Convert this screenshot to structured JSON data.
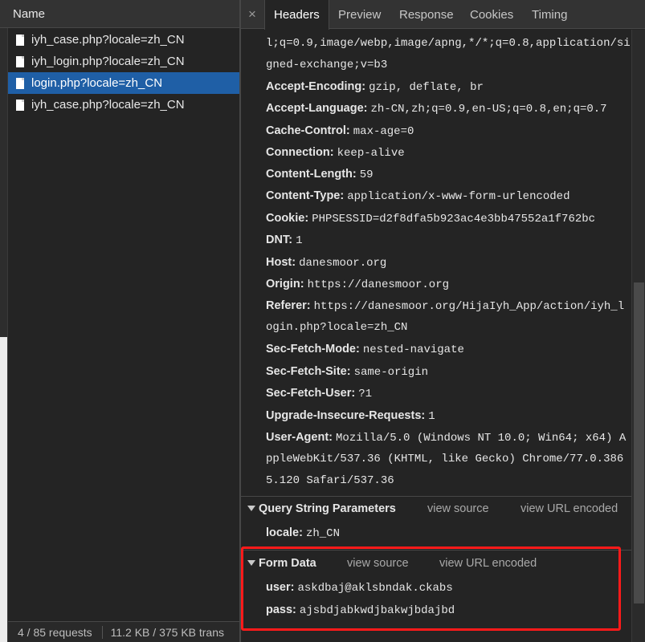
{
  "request_list": {
    "header": "Name",
    "items": [
      {
        "name": "iyh_case.php?locale=zh_CN",
        "selected": false
      },
      {
        "name": "iyh_login.php?locale=zh_CN",
        "selected": false
      },
      {
        "name": "login.php?locale=zh_CN",
        "selected": true
      },
      {
        "name": "iyh_case.php?locale=zh_CN",
        "selected": false
      }
    ],
    "status_requests": "4 / 85 requests",
    "status_size": "11.2 KB / 375 KB trans"
  },
  "tabs": {
    "close": "×",
    "items": [
      "Headers",
      "Preview",
      "Response",
      "Cookies",
      "Timing"
    ],
    "active": "Headers"
  },
  "headers": {
    "accept_cont1": "l;q=0.9,image/webp,image/apng,*/*;q=0.8,application/si",
    "accept_cont2": "gned-exchange;v=b3",
    "rows": [
      {
        "key": "Accept-Encoding:",
        "value": "gzip, deflate, br"
      },
      {
        "key": "Accept-Language:",
        "value": "zh-CN,zh;q=0.9,en-US;q=0.8,en;q=0.7"
      },
      {
        "key": "Cache-Control:",
        "value": "max-age=0"
      },
      {
        "key": "Connection:",
        "value": "keep-alive"
      },
      {
        "key": "Content-Length:",
        "value": "59"
      },
      {
        "key": "Content-Type:",
        "value": "application/x-www-form-urlencoded"
      },
      {
        "key": "Cookie:",
        "value": "PHPSESSID=d2f8dfa5b923ac4e3bb47552a1f762bc"
      },
      {
        "key": "DNT:",
        "value": "1"
      },
      {
        "key": "Host:",
        "value": "danesmoor.org"
      },
      {
        "key": "Origin:",
        "value": "https://danesmoor.org"
      },
      {
        "key": "Referer:",
        "value": "https://danesmoor.org/HijaIyh_App/action/iyh_l"
      },
      {
        "key": "Sec-Fetch-Mode:",
        "value": "nested-navigate"
      },
      {
        "key": "Sec-Fetch-Site:",
        "value": "same-origin"
      },
      {
        "key": "Sec-Fetch-User:",
        "value": "?1"
      },
      {
        "key": "Upgrade-Insecure-Requests:",
        "value": "1"
      },
      {
        "key": "User-Agent:",
        "value": "Mozilla/5.0 (Windows NT 10.0; Win64; x64) A"
      }
    ],
    "referer_cont": "ogin.php?locale=zh_CN",
    "ua_cont1": "ppleWebKit/537.36 (KHTML, like Gecko) Chrome/77.0.386",
    "ua_cont2": "5.120 Safari/537.36"
  },
  "query_string": {
    "title": "Query String Parameters",
    "view_source": "view source",
    "view_url_encoded": "view URL encoded",
    "params": [
      {
        "key": "locale:",
        "value": "zh_CN"
      }
    ]
  },
  "form_data": {
    "title": "Form Data",
    "view_source": "view source",
    "view_url_encoded": "view URL encoded",
    "params": [
      {
        "key": "user:",
        "value": "askdbaj@aklsbndak.ckabs"
      },
      {
        "key": "pass:",
        "value": "ajsbdjabkwdjbakwjbdajbd"
      }
    ]
  },
  "colors": {
    "selected": "#1f5fa6",
    "highlight": "#ff1a1a",
    "background": "#242424"
  }
}
